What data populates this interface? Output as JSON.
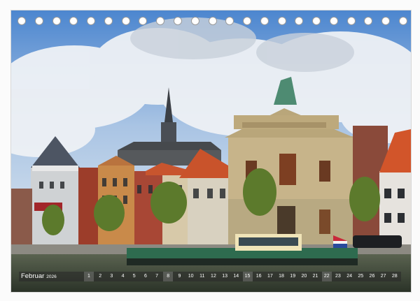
{
  "calendar": {
    "month": "Februar",
    "year": "2026",
    "days": [
      "1",
      "2",
      "3",
      "4",
      "5",
      "6",
      "7",
      "8",
      "9",
      "10",
      "11",
      "12",
      "13",
      "14",
      "15",
      "16",
      "17",
      "18",
      "19",
      "20",
      "21",
      "22",
      "23",
      "24",
      "25",
      "26",
      "27",
      "28"
    ],
    "sundays": [
      "1",
      "8",
      "15",
      "22"
    ]
  },
  "binding": {
    "hole_count": 23
  },
  "colors": {
    "sky": "#6f9fd6",
    "water": "#3d4a3f",
    "brick": "#9c3d2a",
    "stone": "#c7b48a",
    "boat_body": "#2e6b4f"
  }
}
